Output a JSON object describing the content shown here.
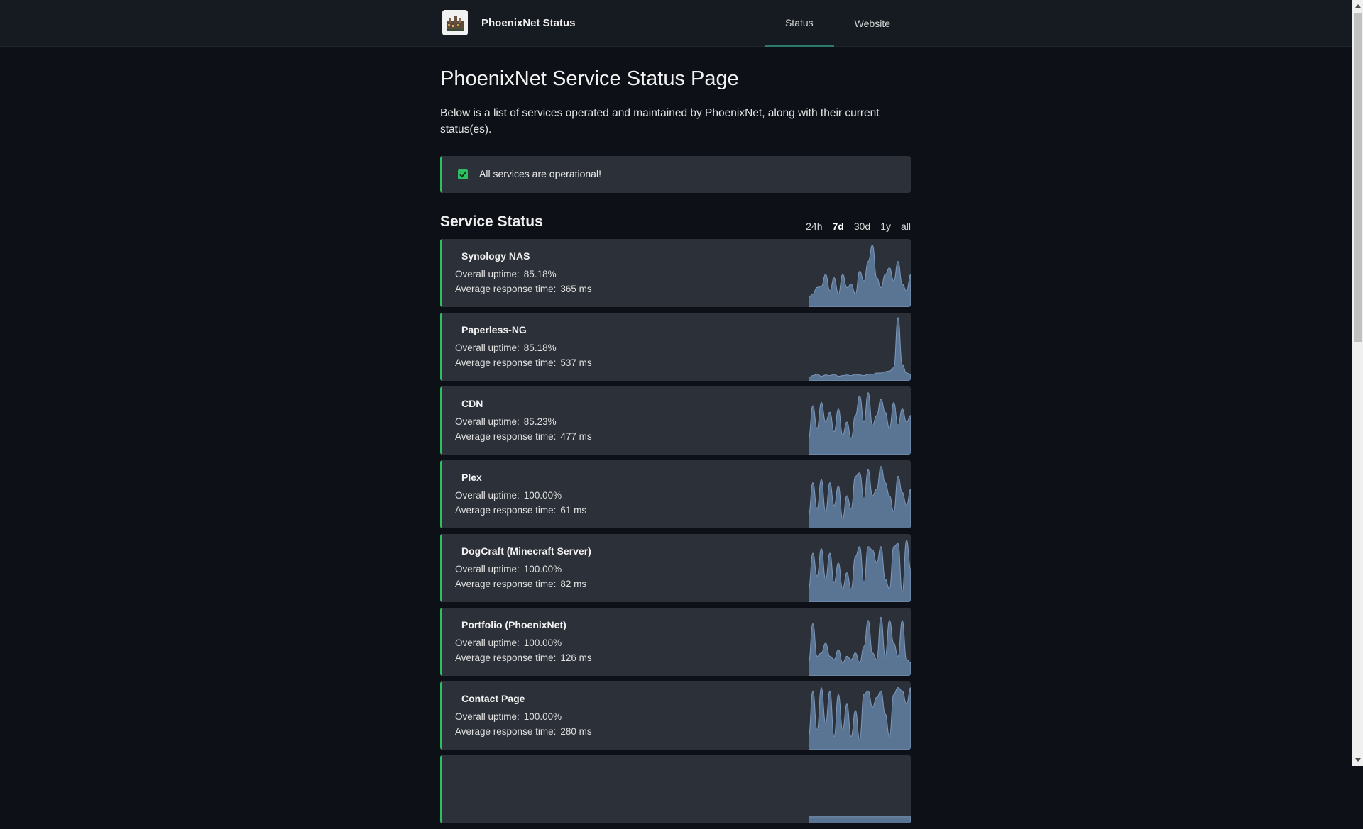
{
  "header": {
    "brand": "PhoenixNet Status",
    "logo_icon": "phoenixnet-logo",
    "nav": [
      {
        "label": "Status",
        "active": true
      },
      {
        "label": "Website",
        "active": false
      }
    ]
  },
  "page": {
    "title": "PhoenixNet Service Status Page",
    "description": "Below is a list of services operated and maintained by PhoenixNet, along with their current status(es)."
  },
  "alert": {
    "icon": "check-icon",
    "text": "All services are operational!",
    "color": "#2ebf62"
  },
  "section": {
    "title": "Service Status",
    "ranges": [
      {
        "label": "24h",
        "active": false
      },
      {
        "label": "7d",
        "active": true
      },
      {
        "label": "30d",
        "active": false
      },
      {
        "label": "1y",
        "active": false
      },
      {
        "label": "all",
        "active": false
      }
    ]
  },
  "labels": {
    "uptime": "Overall uptime:",
    "response": "Average response time:"
  },
  "services": [
    {
      "name": "Synology NAS",
      "uptime": "85.18%",
      "response": "365 ms",
      "spark": [
        0.15,
        0.2,
        0.3,
        0.32,
        0.5,
        0.25,
        0.45,
        0.2,
        0.5,
        0.3,
        0.35,
        0.2,
        0.55,
        0.4,
        0.7,
        0.95,
        0.45,
        0.3,
        0.5,
        0.6,
        0.4,
        0.7,
        0.35,
        0.25,
        0.5
      ]
    },
    {
      "name": "Paperless-NG",
      "uptime": "85.18%",
      "response": "537 ms",
      "spark": [
        0.05,
        0.08,
        0.1,
        0.07,
        0.09,
        0.08,
        0.1,
        0.07,
        0.08,
        0.09,
        0.08,
        0.1,
        0.09,
        0.08,
        0.1,
        0.1,
        0.12,
        0.12,
        0.14,
        0.15,
        0.2,
        0.97,
        0.25,
        0.12,
        0.1
      ]
    },
    {
      "name": "CDN",
      "uptime": "85.23%",
      "response": "477 ms",
      "spark": [
        0.25,
        0.75,
        0.4,
        0.8,
        0.5,
        0.65,
        0.35,
        0.7,
        0.3,
        0.5,
        0.25,
        0.6,
        0.9,
        0.5,
        0.95,
        0.45,
        0.6,
        0.85,
        0.65,
        0.4,
        0.8,
        0.45,
        0.7,
        0.5,
        0.6
      ]
    },
    {
      "name": "Plex",
      "uptime": "100.00%",
      "response": "61 ms",
      "spark": [
        0.2,
        0.7,
        0.3,
        0.75,
        0.25,
        0.7,
        0.35,
        0.65,
        0.15,
        0.5,
        0.3,
        0.8,
        0.85,
        0.45,
        0.9,
        0.5,
        0.6,
        0.95,
        0.7,
        0.5,
        0.25,
        0.8,
        0.55,
        0.35,
        0.6
      ]
    },
    {
      "name": "DogCraft (Minecraft Server)",
      "uptime": "100.00%",
      "response": "82 ms",
      "spark": [
        0.2,
        0.75,
        0.4,
        0.82,
        0.35,
        0.75,
        0.3,
        0.6,
        0.2,
        0.45,
        0.2,
        0.7,
        0.85,
        0.3,
        0.85,
        0.8,
        0.6,
        0.85,
        0.35,
        0.2,
        0.85,
        0.9,
        0.15,
        0.95,
        0.5
      ]
    },
    {
      "name": "Portfolio (PhoenixNet)",
      "uptime": "100.00%",
      "response": "126 ms",
      "spark": [
        0.2,
        0.8,
        0.3,
        0.35,
        0.5,
        0.3,
        0.25,
        0.4,
        0.2,
        0.3,
        0.25,
        0.35,
        0.2,
        0.45,
        0.85,
        0.35,
        0.25,
        0.9,
        0.3,
        0.85,
        0.5,
        0.3,
        0.85,
        0.25,
        0.2
      ]
    },
    {
      "name": "Contact Page",
      "uptime": "100.00%",
      "response": "280 ms",
      "spark": [
        0.2,
        0.9,
        0.3,
        0.95,
        0.4,
        0.9,
        0.2,
        0.85,
        0.3,
        0.7,
        0.2,
        0.6,
        0.15,
        0.85,
        0.9,
        0.65,
        0.8,
        0.9,
        0.55,
        0.2,
        0.85,
        0.95,
        0.9,
        0.7,
        0.95
      ]
    },
    {
      "name": "",
      "uptime": "",
      "response": "",
      "spark": [
        0.1,
        0.1,
        0.1,
        0.1,
        0.1,
        0.1,
        0.1,
        0.1,
        0.1,
        0.1,
        0.1,
        0.1,
        0.1,
        0.1,
        0.1,
        0.1,
        0.1,
        0.1,
        0.1,
        0.1,
        0.1,
        0.1,
        0.1,
        0.1,
        0.1
      ]
    }
  ],
  "colors": {
    "background": "#0d1117",
    "header": "#161b22",
    "card": "#2c3038",
    "ok": "#2ebf62",
    "spark_fill": "#5a7494",
    "spark_line": "#7d98ba"
  }
}
